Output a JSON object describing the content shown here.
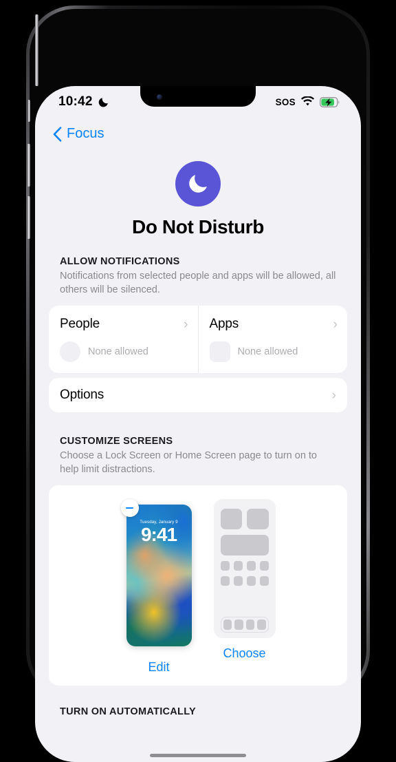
{
  "status_bar": {
    "time": "10:42",
    "moon_icon": "crescent-moon-icon",
    "sos": "SOS",
    "wifi_icon": "wifi-icon",
    "battery_icon": "battery-charging-icon",
    "battery_color": "#34C759"
  },
  "nav": {
    "back_label": "Focus",
    "back_icon": "chevron-left-icon",
    "accent": "#0A84FF"
  },
  "focus": {
    "title": "Do Not Disturb",
    "icon": "crescent-moon-icon",
    "icon_color": "#5A55D6"
  },
  "allow_notifications": {
    "section_title": "ALLOW NOTIFICATIONS",
    "description": "Notifications from selected people and apps will be allowed, all others will be silenced.",
    "cells": [
      {
        "label": "People",
        "value": "None allowed",
        "placeholder_shape": "circle",
        "chevron": "›"
      },
      {
        "label": "Apps",
        "value": "None allowed",
        "placeholder_shape": "square",
        "chevron": "›"
      }
    ],
    "options": {
      "label": "Options",
      "chevron": "›"
    }
  },
  "customize_screens": {
    "section_title": "CUSTOMIZE SCREENS",
    "description": "Choose a Lock Screen or Home Screen page to turn on to help limit distractions.",
    "lock_screen": {
      "date": "Tuesday, January 9",
      "time": "9:41",
      "action_label": "Edit",
      "remove_badge_icon": "minus-circle-icon"
    },
    "home_screen": {
      "action_label": "Choose",
      "placeholder_icon": "home-screen-placeholder-icon"
    }
  },
  "turn_on_automatically": {
    "section_title": "TURN ON AUTOMATICALLY"
  }
}
